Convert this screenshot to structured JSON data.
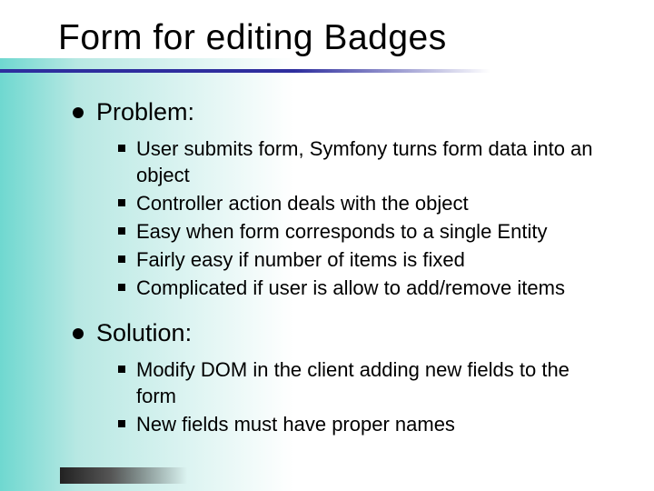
{
  "title": "Form for editing Badges",
  "sections": [
    {
      "label": "Problem:",
      "items": [
        "User submits form, Symfony turns form data into an object",
        "Controller action deals with the object",
        "Easy when form corresponds to a single Entity",
        "Fairly easy if number of items is fixed",
        "Complicated if user is allow to add/remove items"
      ]
    },
    {
      "label": "Solution:",
      "items": [
        "Modify DOM in the client adding new fields to the form",
        "New fields must have proper names"
      ]
    }
  ]
}
